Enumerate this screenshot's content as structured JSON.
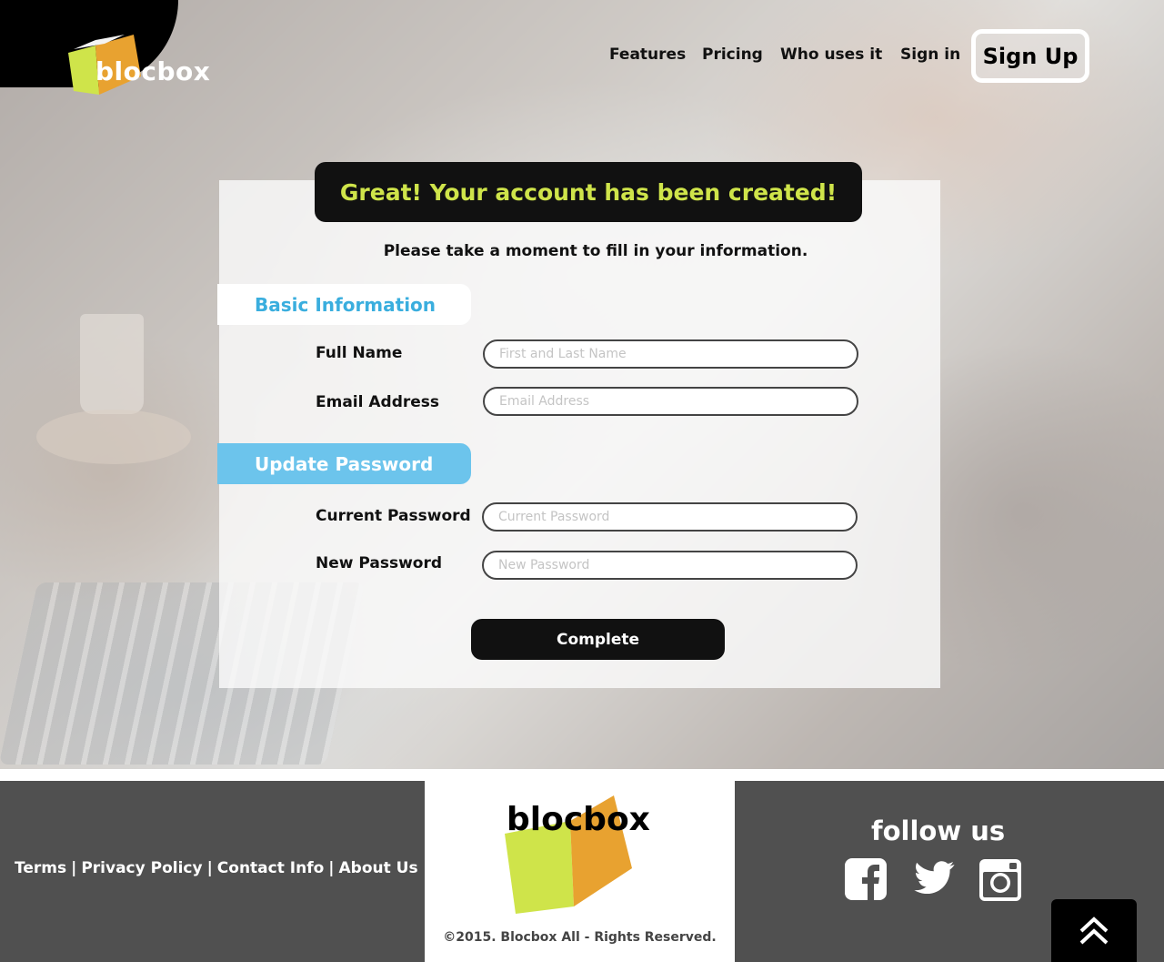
{
  "brand": {
    "name": "blocbox",
    "colors": {
      "lime": "#cfe44a",
      "orange": "#e8a230",
      "cyan": "#3aaede",
      "tab_blue": "#6cc4ec",
      "dark": "#111111",
      "footer_gray": "#505050"
    }
  },
  "nav": {
    "items": [
      {
        "label": "Features"
      },
      {
        "label": "Pricing"
      },
      {
        "label": "Who uses it"
      },
      {
        "label": "Sign in"
      }
    ],
    "signup_label": "Sign Up"
  },
  "form": {
    "banner": "Great! Your account has been created!",
    "subtitle": "Please take a moment to fill in your information.",
    "sections": {
      "basic": "Basic Information",
      "password": "Update Password"
    },
    "fields": {
      "full_name": {
        "label": "Full Name",
        "placeholder": "First and Last Name",
        "value": ""
      },
      "email": {
        "label": "Email Address",
        "placeholder": "Email Address",
        "value": ""
      },
      "current_password": {
        "label": "Current Password",
        "placeholder": "Current Password",
        "value": ""
      },
      "new_password": {
        "label": "New Password",
        "placeholder": "New Password",
        "value": ""
      }
    },
    "submit_label": "Complete"
  },
  "footer": {
    "links": [
      "Terms",
      "Privacy Policy",
      "Contact Info",
      "About Us"
    ],
    "separator": "|",
    "copyright": "©2015. Blocbox All - Rights Reserved.",
    "follow_us": "follow us",
    "social_icons": [
      "facebook-icon",
      "twitter-icon",
      "instagram-icon"
    ],
    "back_to_top_icon": "double-chevron-up-icon"
  }
}
